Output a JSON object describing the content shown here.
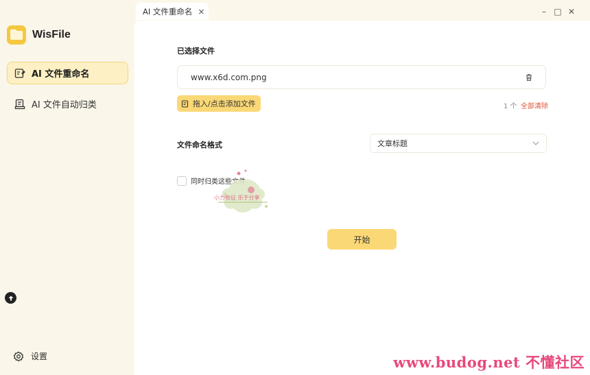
{
  "app": {
    "name": "WisFile"
  },
  "sidebar": {
    "items": [
      {
        "label": "AI 文件重命名",
        "icon": "rename-file-icon",
        "active": true
      },
      {
        "label": "AI 文件自动归类",
        "icon": "archive-file-icon",
        "active": false
      }
    ],
    "settings_label": "设置"
  },
  "tabs": [
    {
      "label": "AI 文件重命名",
      "close": "×"
    }
  ],
  "window_controls": {
    "minimize": "–",
    "maximize": "□",
    "close": "✕"
  },
  "main": {
    "selected_files_label": "已选择文件",
    "files": [
      {
        "name": "www.x6d.com.png"
      }
    ],
    "add_button_label": "拖入/点击添加文件",
    "file_count": "1 个",
    "clear_all_label": "全部清除",
    "naming_format_label": "文件命名格式",
    "naming_format_value": "文章标题",
    "also_classify_label": "同时归类这些文件",
    "also_classify_checked": false,
    "start_button_label": "开始"
  },
  "overlay": {
    "watermark_text": "小力牧征 乐于分享",
    "site_mark": "www.budog.net 不懂社区"
  },
  "colors": {
    "accent": "#fbd876",
    "active_nav_bg": "#fdf0c4",
    "danger": "#e0563b",
    "sidebar_bg": "#faf6e9"
  }
}
